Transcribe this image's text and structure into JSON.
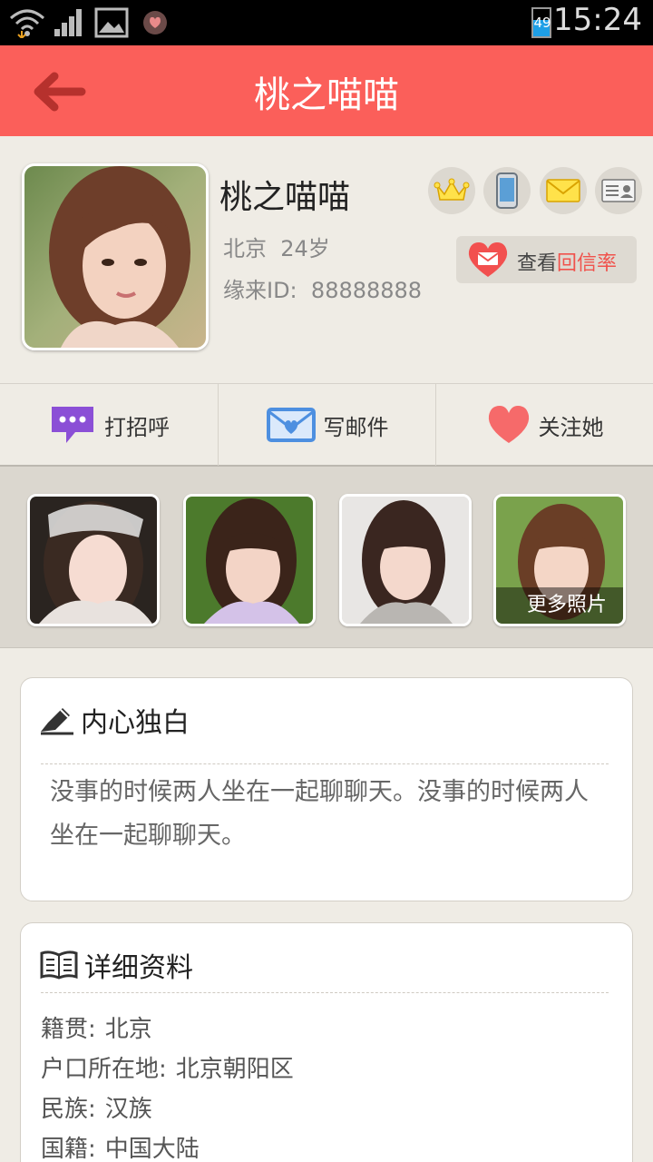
{
  "status_bar": {
    "battery": "49",
    "time": "15:24"
  },
  "header": {
    "title": "桃之喵喵"
  },
  "profile": {
    "name": "桃之喵喵",
    "city": "北京",
    "age": "24岁",
    "id_label": "缘来ID:",
    "id_value": "88888888",
    "rate_prefix": "查看",
    "rate_highlight": "回信率"
  },
  "actions": [
    {
      "label": "打招呼"
    },
    {
      "label": "写邮件"
    },
    {
      "label": "关注她"
    }
  ],
  "photos": {
    "more_label": "更多照片"
  },
  "monologue": {
    "title": "内心独白",
    "text": "没事的时候两人坐在一起聊聊天。没事的时候两人坐在一起聊聊天。"
  },
  "details": {
    "title": "详细资料",
    "rows": [
      {
        "label": "籍贯:",
        "value": "北京"
      },
      {
        "label": "户口所在地:",
        "value": "北京朝阳区"
      },
      {
        "label": "民族:",
        "value": "汉族"
      },
      {
        "label": "国籍:",
        "value": "中国大陆"
      }
    ]
  },
  "colors": {
    "accent": "#fb5f5a",
    "highlight": "#f0524c",
    "background": "#efece5"
  }
}
